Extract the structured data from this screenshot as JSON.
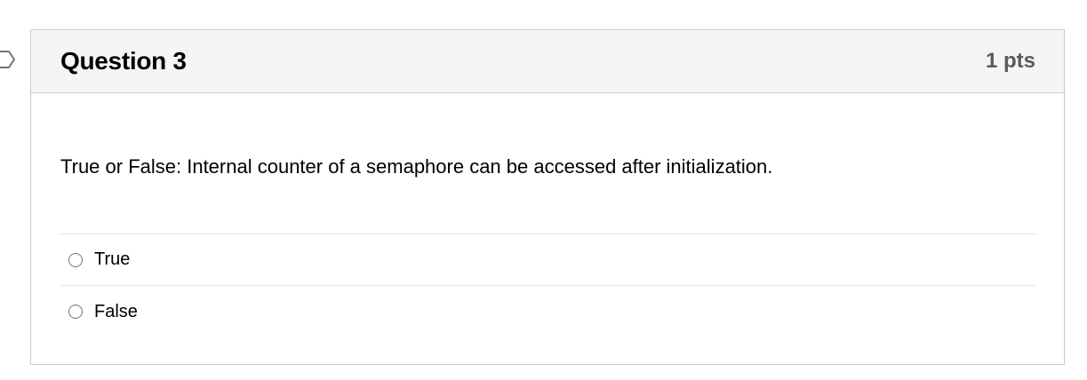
{
  "question": {
    "title": "Question 3",
    "points": "1 pts",
    "text": "True or False: Internal counter of a semaphore can be accessed after initialization.",
    "flag_icon": "flag-outline-icon"
  },
  "answers": [
    {
      "label": "True",
      "selected": false
    },
    {
      "label": "False",
      "selected": false
    }
  ],
  "colors": {
    "header_bg": "#f5f5f5",
    "border": "#c7cdd1",
    "divider": "#e6e6e6",
    "points_text": "#5a5a5a"
  }
}
